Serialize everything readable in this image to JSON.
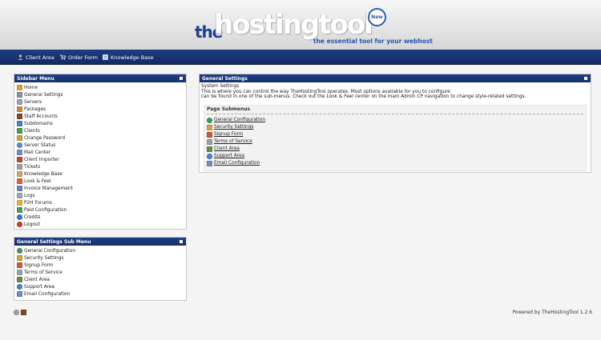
{
  "header": {
    "logo_the": "the",
    "logo_main": "hostingtool",
    "logo_badge": "New",
    "tagline": "the essential tool for your webhost"
  },
  "nav": {
    "items": [
      {
        "label": "Client Area",
        "icon": "user-icon"
      },
      {
        "label": "Order Form",
        "icon": "cart-icon"
      },
      {
        "label": "Knowledge Base",
        "icon": "book-icon"
      }
    ]
  },
  "sidebar": {
    "title": "Sidebar Menu",
    "items": [
      {
        "label": "Home",
        "icon": "home-icon",
        "color": "#d9a23a"
      },
      {
        "label": "General Settings",
        "icon": "gear-icon",
        "color": "#8a8f9a"
      },
      {
        "label": "Servers",
        "icon": "server-icon",
        "color": "#9aa4b3"
      },
      {
        "label": "Packages",
        "icon": "package-icon",
        "color": "#c98a3d"
      },
      {
        "label": "Staff Accounts",
        "icon": "staff-icon",
        "color": "#7a4a2a"
      },
      {
        "label": "Subdomains",
        "icon": "network-icon",
        "color": "#4a7fc9"
      },
      {
        "label": "Clients",
        "icon": "clients-icon",
        "color": "#4c9a4a"
      },
      {
        "label": "Change Password",
        "icon": "key-icon",
        "color": "#c9a13a"
      },
      {
        "label": "Server Status",
        "icon": "status-icon",
        "color": "#5a8bd1"
      },
      {
        "label": "Mail Center",
        "icon": "mail-icon",
        "color": "#6f8fc4"
      },
      {
        "label": "Client Importer",
        "icon": "importer-icon",
        "color": "#b24b3a"
      },
      {
        "label": "Tickets",
        "icon": "ticket-icon",
        "color": "#9aa0a8"
      },
      {
        "label": "Knowledge Base",
        "icon": "book-icon",
        "color": "#c7a96a"
      },
      {
        "label": "Look & Feel",
        "icon": "palette-icon",
        "color": "#d8613a"
      },
      {
        "label": "Invoice Management",
        "icon": "invoice-icon",
        "color": "#6c86b8"
      },
      {
        "label": "Logs",
        "icon": "log-icon",
        "color": "#a0a4ab"
      },
      {
        "label": "P2H Forums",
        "icon": "forum-icon",
        "color": "#e0b23a"
      },
      {
        "label": "Paid Configuration",
        "icon": "money-icon",
        "color": "#4d9e5b"
      },
      {
        "label": "Credits",
        "icon": "info-icon",
        "color": "#3a74c9"
      },
      {
        "label": "Logout",
        "icon": "logout-icon",
        "color": "#c93a3a"
      }
    ]
  },
  "submenu": {
    "title": "General Settings Sub Menu",
    "items": [
      {
        "label": "General Configuration",
        "icon": "globe-icon",
        "color": "#3f9a5f"
      },
      {
        "label": "Security Settings",
        "icon": "lock-icon",
        "color": "#d5a13a"
      },
      {
        "label": "Signup Form",
        "icon": "signup-icon",
        "color": "#c95a3a"
      },
      {
        "label": "Terms of Service",
        "icon": "document-icon",
        "color": "#9aa0a8"
      },
      {
        "label": "Client Area",
        "icon": "user-icon",
        "color": "#6a8a4a"
      },
      {
        "label": "Support Area",
        "icon": "help-icon",
        "color": "#4a7fc9"
      },
      {
        "label": "Email Configuration",
        "icon": "mail-icon",
        "color": "#6f8fc4"
      }
    ]
  },
  "main": {
    "title": "General Settings",
    "heading": "System Settings",
    "desc1": "This is where you can control the way TheHostingTool operates. Most options available for you to configure",
    "desc2": "can be found in one of the sub-menus. Check out the Look & Feel center on the main Admin CP navigation to change style-related settings.",
    "sub_title": "Page Submenus",
    "links": [
      {
        "label": "General Configuration",
        "icon": "globe-icon",
        "color": "#3f9a5f"
      },
      {
        "label": "Security Settings",
        "icon": "lock-icon",
        "color": "#d5a13a"
      },
      {
        "label": "Signup Form",
        "icon": "signup-icon",
        "color": "#c95a3a"
      },
      {
        "label": "Terms of Service",
        "icon": "document-icon",
        "color": "#9aa0a8"
      },
      {
        "label": "Client Area",
        "icon": "user-icon",
        "color": "#6a8a4a"
      },
      {
        "label": "Support Area",
        "icon": "help-icon",
        "color": "#4a7fc9"
      },
      {
        "label": "Email Configuration",
        "icon": "mail-icon",
        "color": "#6f8fc4"
      }
    ]
  },
  "footer": {
    "powered": "Powered by TheHostingTool 1.2.6",
    "icons": [
      {
        "icon": "globe-icon",
        "color": "#9aa0a8"
      },
      {
        "icon": "user-icon",
        "color": "#7a4a2a"
      }
    ]
  }
}
